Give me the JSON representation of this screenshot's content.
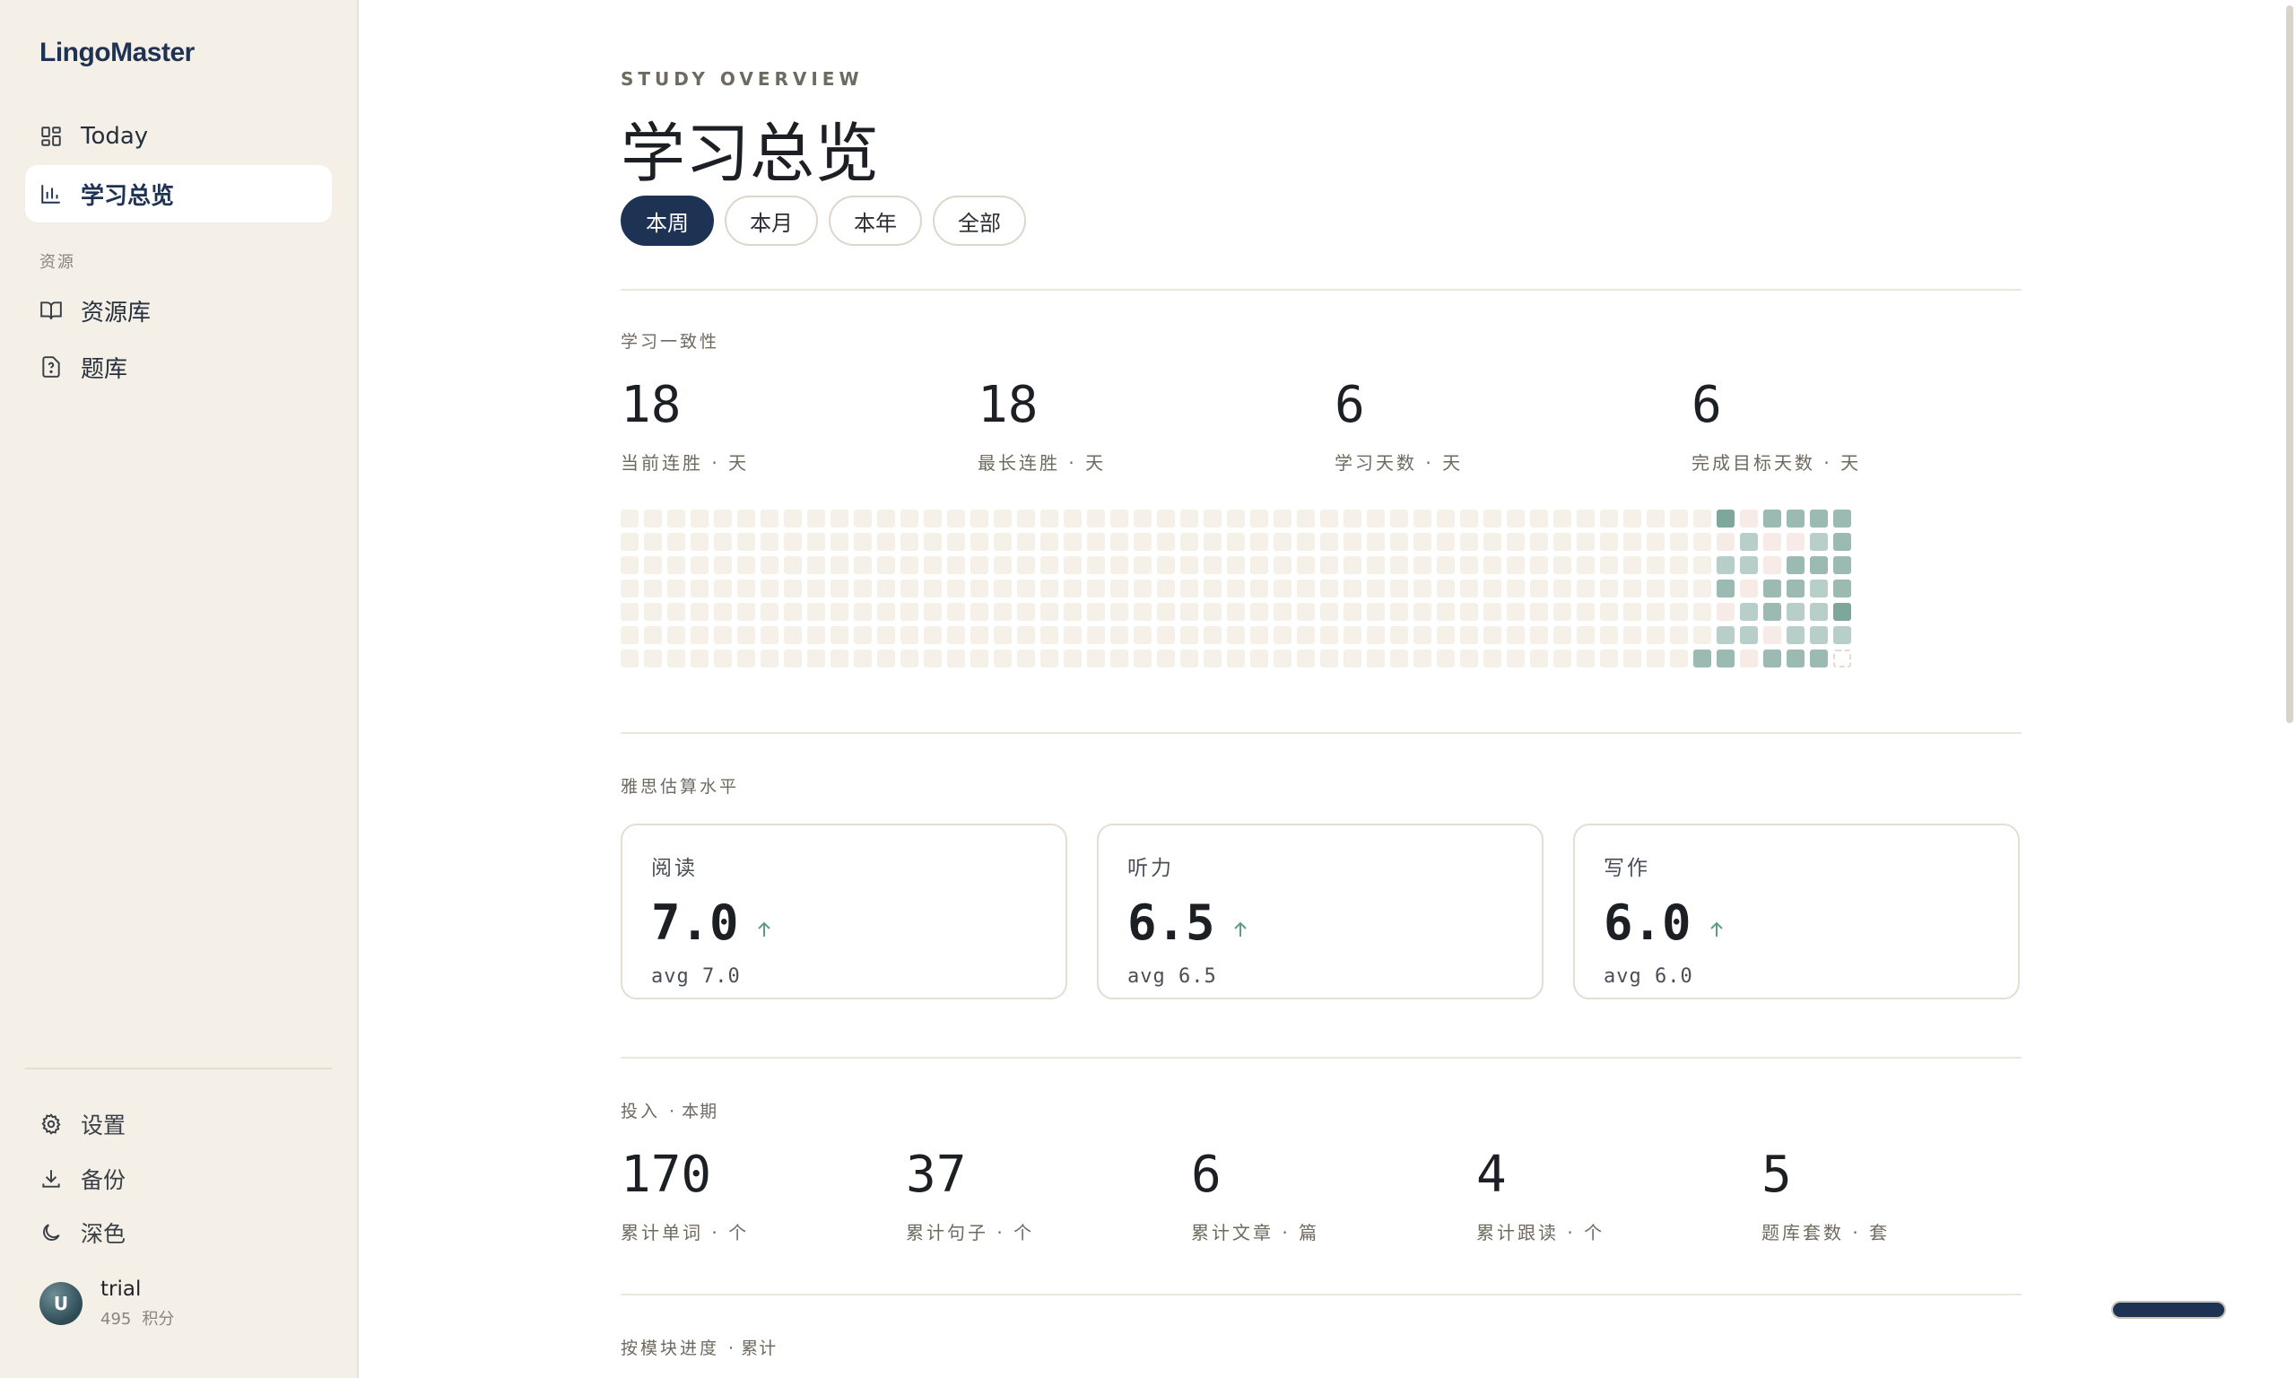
{
  "app": {
    "brand": "LingoMaster"
  },
  "sidebar": {
    "nav": [
      {
        "label": "Today",
        "icon": "grid-icon"
      },
      {
        "label": "学习总览",
        "icon": "bar-chart-icon",
        "active": true
      }
    ],
    "section_title": "资源",
    "resources": [
      {
        "label": "资源库",
        "icon": "book-icon"
      },
      {
        "label": "题库",
        "icon": "question-file-icon"
      }
    ],
    "footer": [
      {
        "label": "设置",
        "icon": "gear-icon"
      },
      {
        "label": "备份",
        "icon": "download-icon"
      },
      {
        "label": "深色",
        "icon": "moon-icon"
      }
    ],
    "user": {
      "initial": "U",
      "name": "trial",
      "points_value": "495",
      "points_unit": "积分"
    }
  },
  "header": {
    "eyebrow": "STUDY OVERVIEW",
    "title": "学习总览",
    "tabs": [
      {
        "label": "本周",
        "active": true
      },
      {
        "label": "本月",
        "active": false
      },
      {
        "label": "本年",
        "active": false
      },
      {
        "label": "全部",
        "active": false
      }
    ]
  },
  "consistency": {
    "label": "学习一致性",
    "stats": [
      {
        "value": "18",
        "label": "当前连胜 · 天"
      },
      {
        "value": "18",
        "label": "最长连胜 · 天"
      },
      {
        "value": "6",
        "label": "学习天数 · 天"
      },
      {
        "value": "6",
        "label": "完成目标天数 · 天"
      }
    ],
    "heatmap": {
      "weeks": 53,
      "days": 7,
      "colors": {
        "empty": "#f5f1e9",
        "level1": "#f6ebe6",
        "level2": "#b8cec8",
        "level3": "#9bbab1",
        "level4": "#7ea79b"
      },
      "active_weeks": [
        [
          0,
          0,
          0,
          0,
          0,
          0,
          3
        ],
        [
          4,
          1,
          2,
          3,
          1,
          2,
          3
        ],
        [
          1,
          2,
          2,
          1,
          2,
          2,
          1
        ],
        [
          3,
          1,
          1,
          3,
          3,
          1,
          3
        ],
        [
          3,
          1,
          3,
          3,
          2,
          2,
          3
        ],
        [
          3,
          2,
          3,
          2,
          2,
          2,
          3
        ],
        [
          3,
          3,
          3,
          3,
          4,
          2,
          "future"
        ]
      ]
    }
  },
  "ielts": {
    "label": "雅思估算水平",
    "cards": [
      {
        "title": "阅读",
        "score": "7.0",
        "avg": "avg 7.0",
        "trend": "up-arrow-icon"
      },
      {
        "title": "听力",
        "score": "6.5",
        "avg": "avg 6.5",
        "trend": "up-arrow-icon"
      },
      {
        "title": "写作",
        "score": "6.0",
        "avg": "avg 6.0",
        "trend": "up-arrow-icon"
      }
    ],
    "accent": "#5f9b86"
  },
  "investment": {
    "label": "投入",
    "sub": "· 本期",
    "stats": [
      {
        "value": "170",
        "label": "累计单词 · 个"
      },
      {
        "value": "37",
        "label": "累计句子 · 个"
      },
      {
        "value": "6",
        "label": "累计文章 · 篇"
      },
      {
        "value": "4",
        "label": "累计跟读 · 个"
      },
      {
        "value": "5",
        "label": "题库套数 · 套"
      }
    ]
  },
  "modules": {
    "label": "按模块进度",
    "sub": "· 累计"
  },
  "theme": {
    "primary": "#1e3354",
    "sidebar_bg": "#f4f0e8"
  }
}
